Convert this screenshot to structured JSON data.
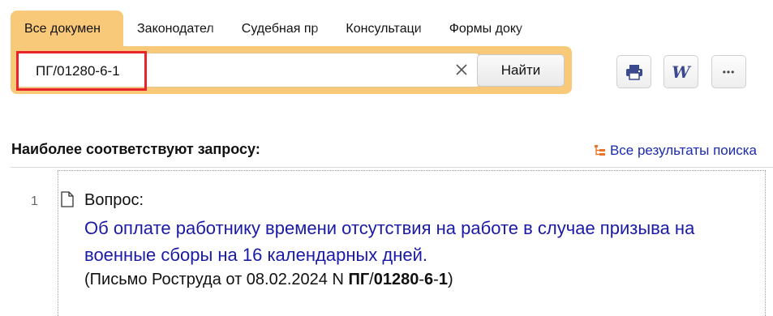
{
  "tabs": [
    {
      "label": "Все докумен"
    },
    {
      "label": "Законодател"
    },
    {
      "label": "Судебная пр"
    },
    {
      "label": "Консультаци"
    },
    {
      "label": "Формы доку"
    }
  ],
  "search": {
    "value": "ПГ/01280-6-1",
    "find_label": "Найти"
  },
  "toolbar": {
    "print_icon": "printer-icon",
    "word_icon": "word-icon",
    "more_icon": "more-icon",
    "word_letter": "W",
    "more_glyph": "•••"
  },
  "results": {
    "heading": "Наиболее соответствуют запросу:",
    "all_results_label": "Все результаты поиска",
    "items": [
      {
        "number": "1",
        "type": "Вопрос:",
        "title": "Об оплате работнику времени отсутствия на работе в случае призыва на военные сборы на 16 календарных дней.",
        "source_prefix": "(Письмо Роструда от 08.02.2024 N ",
        "source_parts": [
          "ПГ",
          "/",
          "01280",
          "-",
          "6",
          "-",
          "1"
        ],
        "source_suffix": ")"
      }
    ]
  },
  "colors": {
    "accent": "#f9c97a",
    "link": "#1a1aa6",
    "highlight": "#e8232a"
  }
}
